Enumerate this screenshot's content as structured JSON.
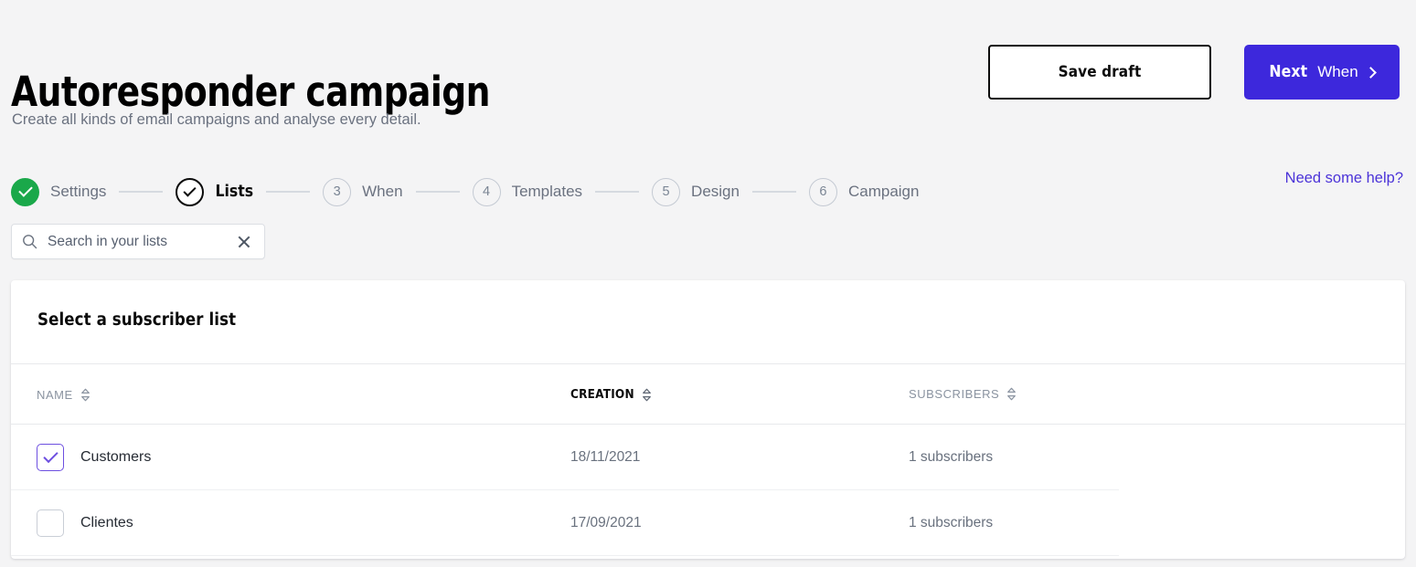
{
  "header": {
    "title": "Autoresponder campaign",
    "subtitle": "Create all kinds of email campaigns and analyse every detail.",
    "save_draft_label": "Save draft",
    "next_label": "Next",
    "next_step_label": "When"
  },
  "help": {
    "label": "Need some help?"
  },
  "stepper": {
    "steps": [
      {
        "number": "1",
        "label": "Settings",
        "state": "done"
      },
      {
        "number": "2",
        "label": "Lists",
        "state": "current"
      },
      {
        "number": "3",
        "label": "When",
        "state": "todo"
      },
      {
        "number": "4",
        "label": "Templates",
        "state": "todo"
      },
      {
        "number": "5",
        "label": "Design",
        "state": "todo"
      },
      {
        "number": "6",
        "label": "Campaign",
        "state": "todo"
      }
    ]
  },
  "search": {
    "placeholder": "Search in your lists",
    "value": ""
  },
  "card": {
    "title": "Select a subscriber list",
    "columns": {
      "name": "NAME",
      "creation": "CREATION",
      "subscribers": "SUBSCRIBERS"
    },
    "rows": [
      {
        "name": "Customers",
        "creation": "18/11/2021",
        "subscribers": "1 subscribers",
        "selected": true
      },
      {
        "name": "Clientes",
        "creation": "17/09/2021",
        "subscribers": "1 subscribers",
        "selected": false
      }
    ]
  },
  "colors": {
    "accent": "#3d28dc",
    "link": "#4b33d8",
    "success": "#1aa84a",
    "checkbox_checked": "#6d4fe0",
    "page_background": "#f4f4f5",
    "card_background": "#ffffff"
  }
}
